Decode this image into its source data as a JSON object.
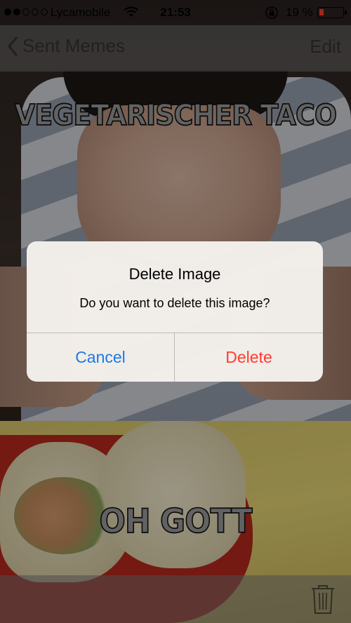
{
  "status_bar": {
    "carrier": "Lycamobile",
    "time": "21:53",
    "battery_percent": "19 %",
    "battery_level": 0.19,
    "signal_bars_full": 2,
    "signal_bars_total": 5,
    "icons": [
      "wifi-icon",
      "rotation-lock-icon",
      "battery-icon"
    ]
  },
  "nav": {
    "back_label": "Sent Memes",
    "edit_label": "Edit"
  },
  "meme": {
    "top_text": "VEGETARISCHER TACO",
    "bottom_text": "OH GOTT"
  },
  "alert": {
    "title": "Delete Image",
    "message": "Do you want to delete this image?",
    "cancel_label": "Cancel",
    "delete_label": "Delete"
  },
  "toolbar": {
    "icons": [
      "trash-icon"
    ]
  },
  "colors": {
    "ios_blue": "#1d7ae6",
    "destructive_red": "#ff3b30",
    "battery_low": "#ff3b30"
  }
}
